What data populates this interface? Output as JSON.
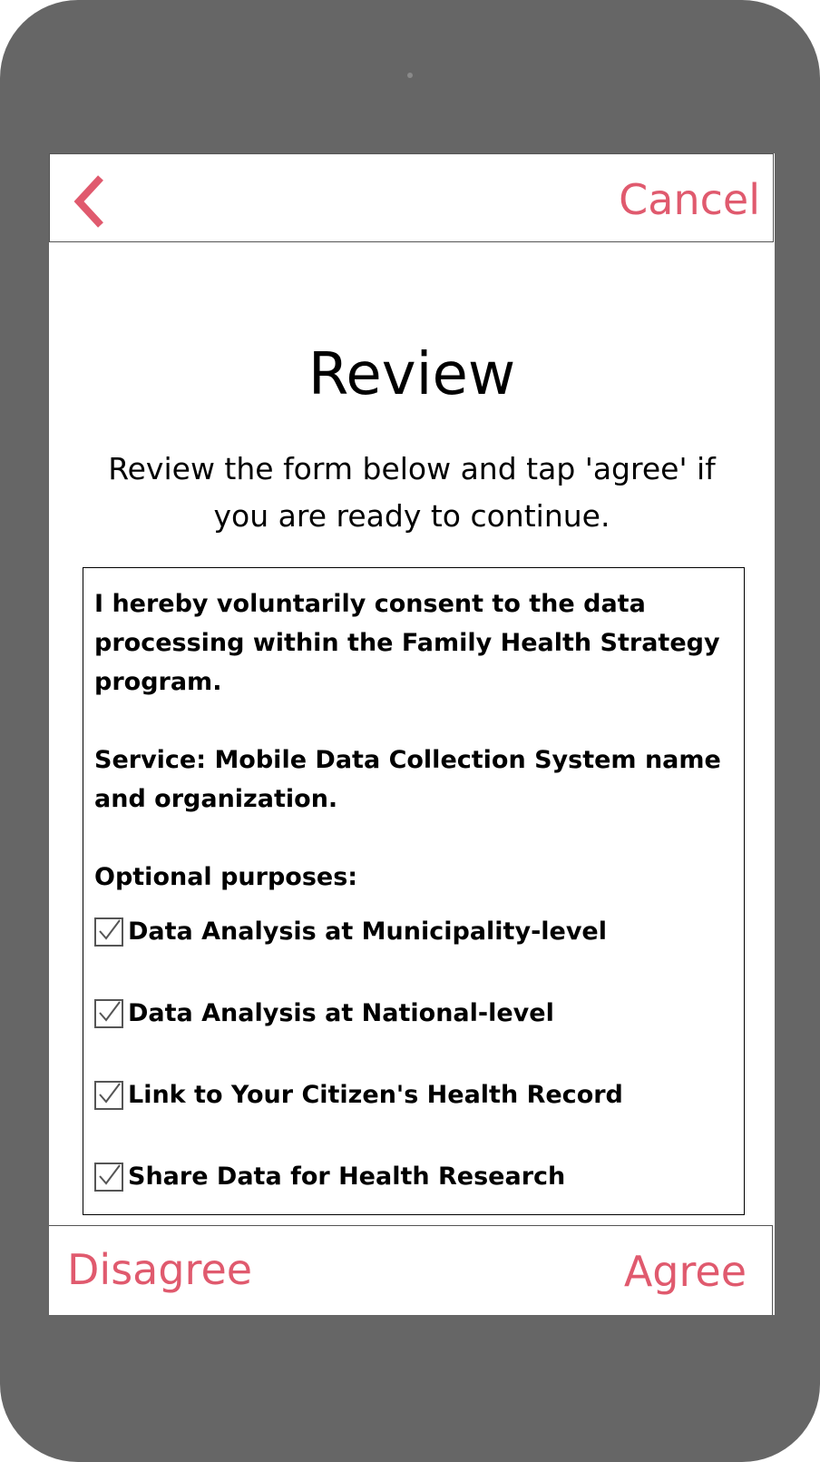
{
  "header": {
    "back_icon": "chevron-left-icon",
    "cancel_label": "Cancel"
  },
  "main": {
    "title": "Review",
    "subtitle": "Review the form below and tap 'agree' if you are ready to continue."
  },
  "form": {
    "consent_text": "I hereby voluntarily consent to the data processing within the Family Health Strategy program.",
    "service_text": "Service: Mobile Data Collection System name and organization.",
    "purposes_heading": "Optional purposes:",
    "purposes": [
      {
        "label": "Data Analysis at Municipality-level",
        "checked": true
      },
      {
        "label": "Data Analysis at National-level",
        "checked": true
      },
      {
        "label": "Link to Your Citizen's Health Record",
        "checked": true
      },
      {
        "label": "Share Data for Health Research",
        "checked": true
      }
    ]
  },
  "footer": {
    "disagree_label": "Disagree",
    "agree_label": "Agree"
  },
  "colors": {
    "accent": "#e05a6e",
    "device_frame": "#666666"
  }
}
